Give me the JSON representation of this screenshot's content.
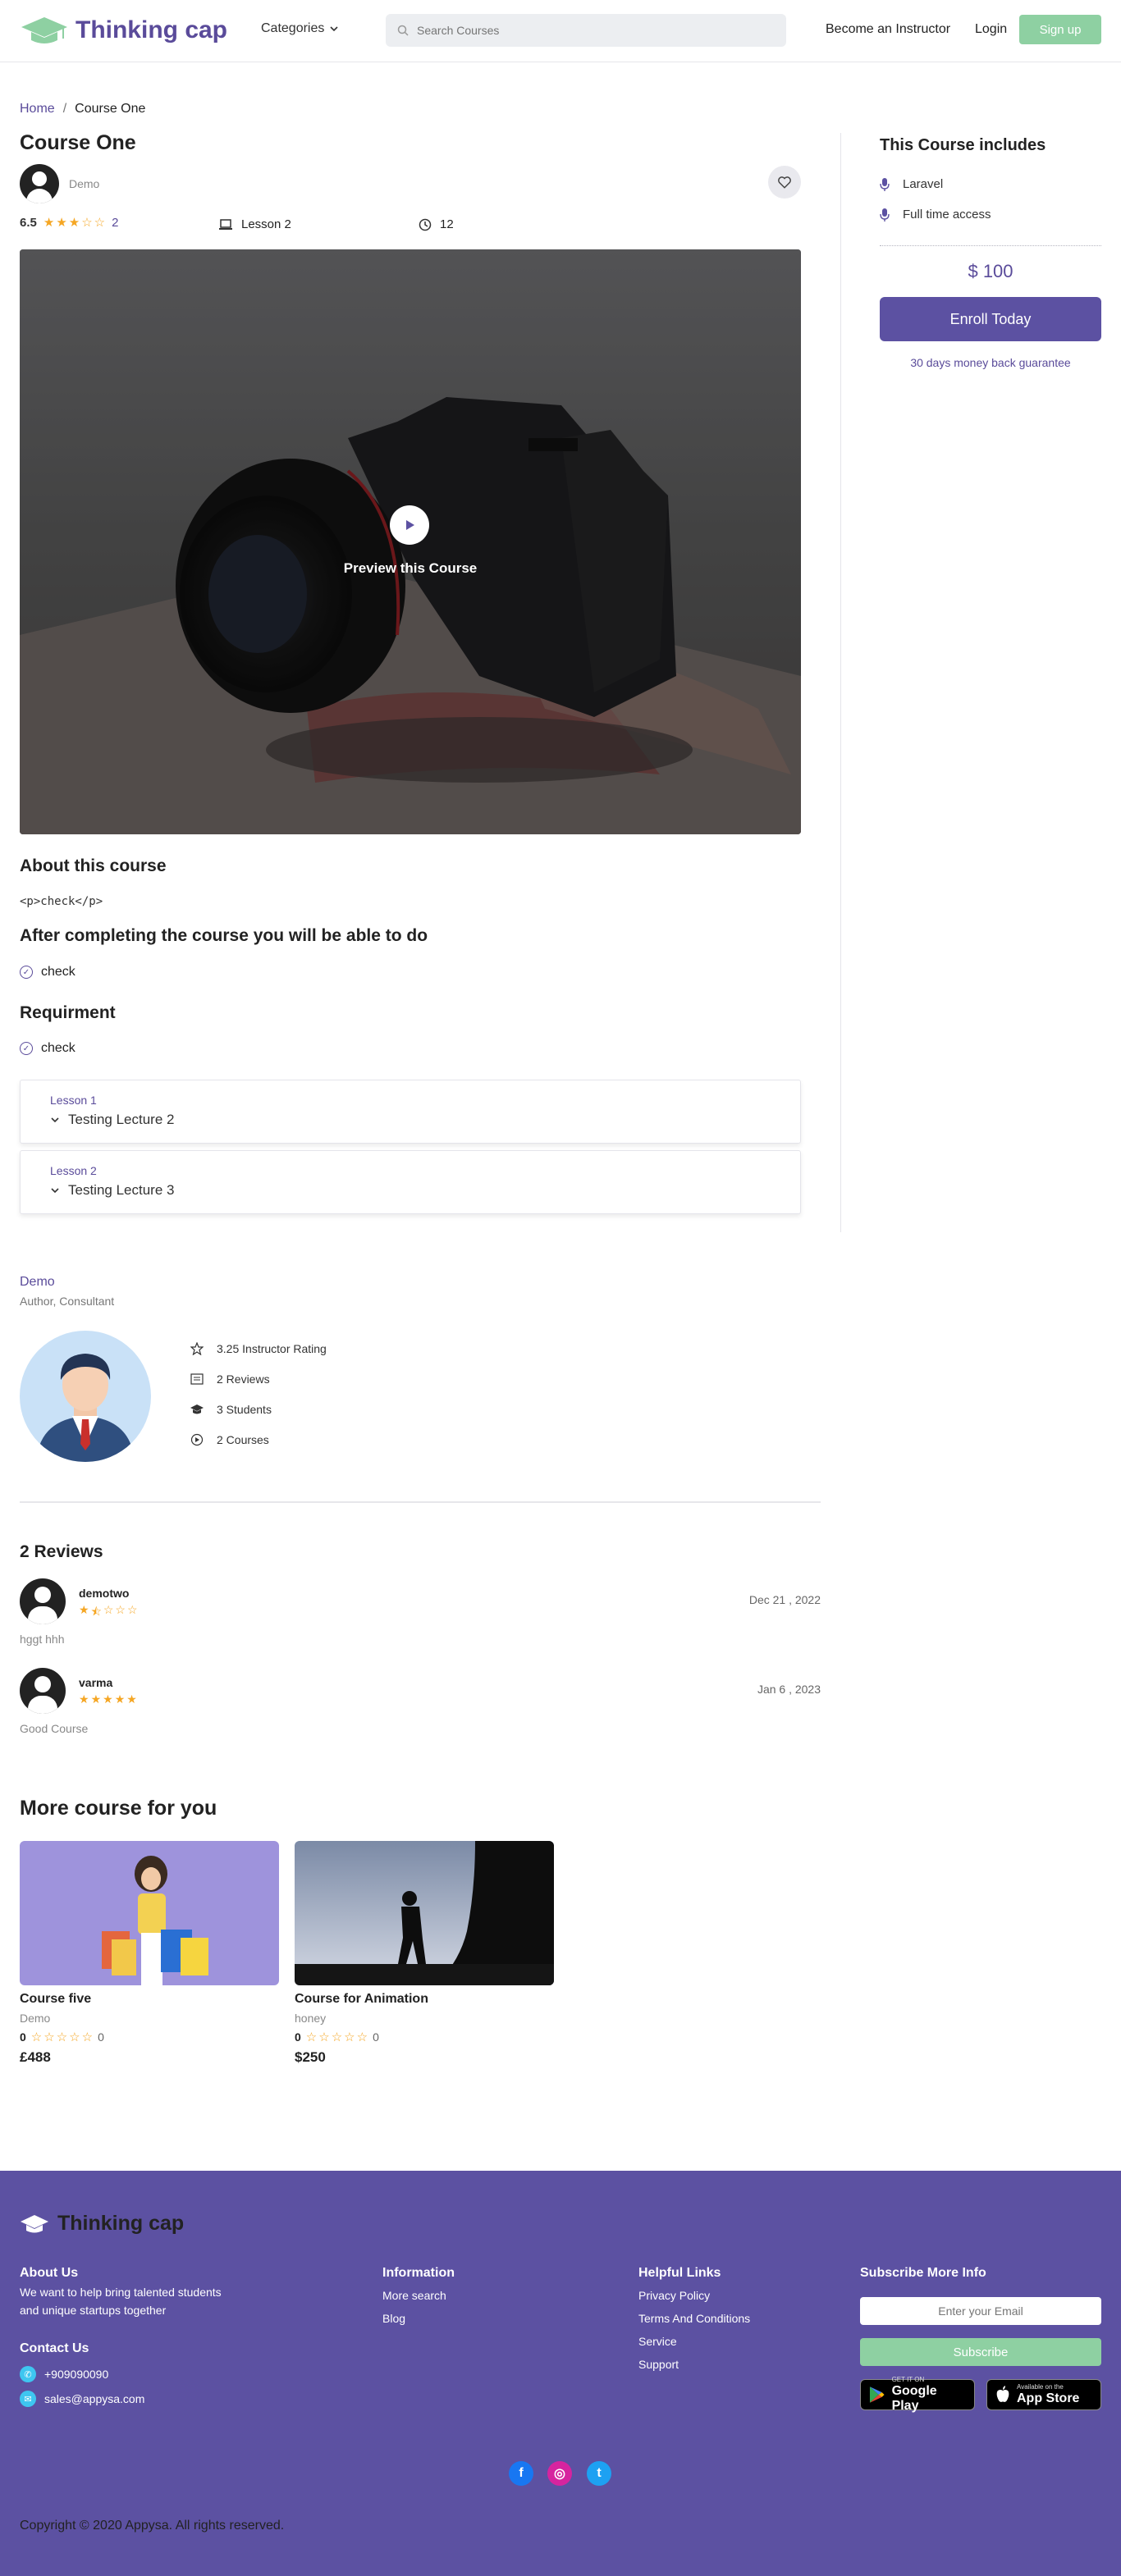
{
  "header": {
    "brand": "Thinking cap",
    "categories": "Categories",
    "search_placeholder": "Search Courses",
    "become_instructor": "Become an Instructor",
    "login": "Login",
    "signup": "Sign up"
  },
  "breadcrumb": {
    "home": "Home",
    "sep": "/",
    "current": "Course One"
  },
  "course": {
    "title": "Course One",
    "author": "Demo",
    "rating": "6.5",
    "rating_stars": 3,
    "reviews_count": "2",
    "lesson": "Lesson 2",
    "duration": "12",
    "preview_label": "Preview this Course"
  },
  "about": {
    "heading": "About this course",
    "text": "<p>check</p>",
    "after_heading": "After completing the course you will be able to do",
    "after_item": "check",
    "req_heading": "Requirment",
    "req_item": "check"
  },
  "lessons": [
    {
      "label": "Lesson 1",
      "title": "Testing Lecture 2"
    },
    {
      "label": "Lesson 2",
      "title": "Testing Lecture 3"
    }
  ],
  "sidebar": {
    "heading": "This Course includes",
    "items": [
      "Laravel",
      "Full time access"
    ],
    "price": "$ 100",
    "enroll": "Enroll Today",
    "guarantee": "30 days money back guarantee"
  },
  "instructor": {
    "name": "Demo",
    "role": "Author, Consultant",
    "stats": [
      "3.25 Instructor Rating",
      "2 Reviews",
      "3 Students",
      "2 Courses"
    ]
  },
  "reviews": {
    "heading": "2 Reviews",
    "items": [
      {
        "name": "demotwo",
        "stars": 1.5,
        "date": "Dec 21 , 2022",
        "text": "hggt hhh"
      },
      {
        "name": "varma",
        "stars": 5,
        "date": "Jan 6 , 2023",
        "text": "Good Course"
      }
    ]
  },
  "more": {
    "heading": "More course for you",
    "cards": [
      {
        "title": "Course five",
        "author": "Demo",
        "rating": "0",
        "count": "0",
        "price": "£488"
      },
      {
        "title": "Course for Animation",
        "author": "honey",
        "rating": "0",
        "count": "0",
        "price": "$250"
      }
    ]
  },
  "footer": {
    "brand": "Thinking cap",
    "about_h": "About Us",
    "about_t1": "We want to help bring talented students",
    "about_t2": "and unique startups together",
    "contact_h": "Contact Us",
    "phone": "+909090090",
    "email": "sales@appysa.com",
    "info_h": "Information",
    "info_links": [
      "More search",
      "Blog"
    ],
    "help_h": "Helpful Links",
    "help_links": [
      "Privacy Policy",
      "Terms And Conditions",
      "Service",
      "Support"
    ],
    "sub_h": "Subscribe More Info",
    "email_placeholder": "Enter your Email",
    "subscribe": "Subscribe",
    "gp_small": "GET IT ON",
    "gp_big": "Google Play",
    "as_small": "Available on the",
    "as_big": "App Store",
    "copyright": "Copyright © 2020 Appysa. All rights reserved."
  },
  "colors": {
    "brand": "#5c51a2",
    "accent_green": "#8ed0a2",
    "star": "#f5a623"
  }
}
